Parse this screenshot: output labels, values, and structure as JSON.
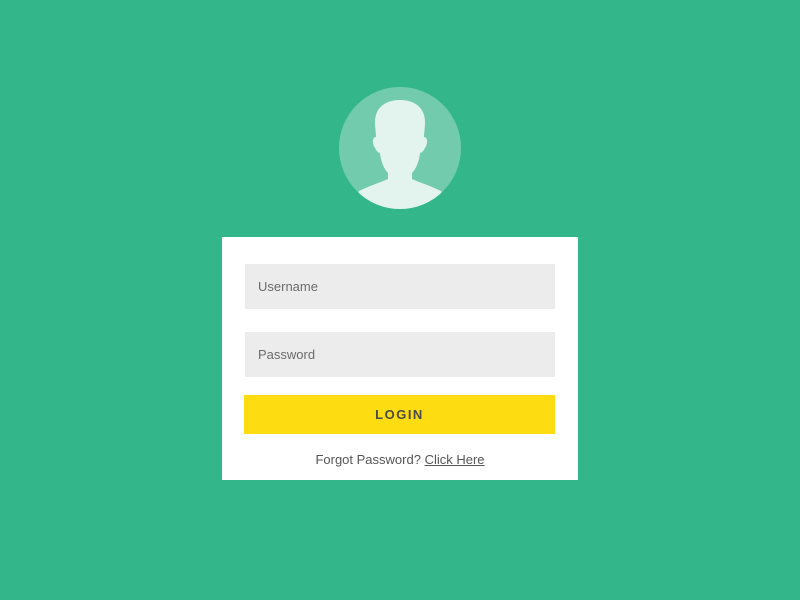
{
  "avatar": {
    "icon": "user-silhouette-icon",
    "circle_color": "#72cbac",
    "figure_color": "#e3f4ee"
  },
  "login_form": {
    "username": {
      "placeholder": "Username",
      "value": ""
    },
    "password": {
      "placeholder": "Password",
      "value": ""
    },
    "login_label": "LOGIN",
    "forgot_text": "Forgot Password?",
    "forgot_link_label": "Click Here"
  },
  "colors": {
    "background": "#32b68a",
    "card": "#ffffff",
    "input_bg": "#ececec",
    "button": "#fedc12",
    "text": "#555555"
  }
}
